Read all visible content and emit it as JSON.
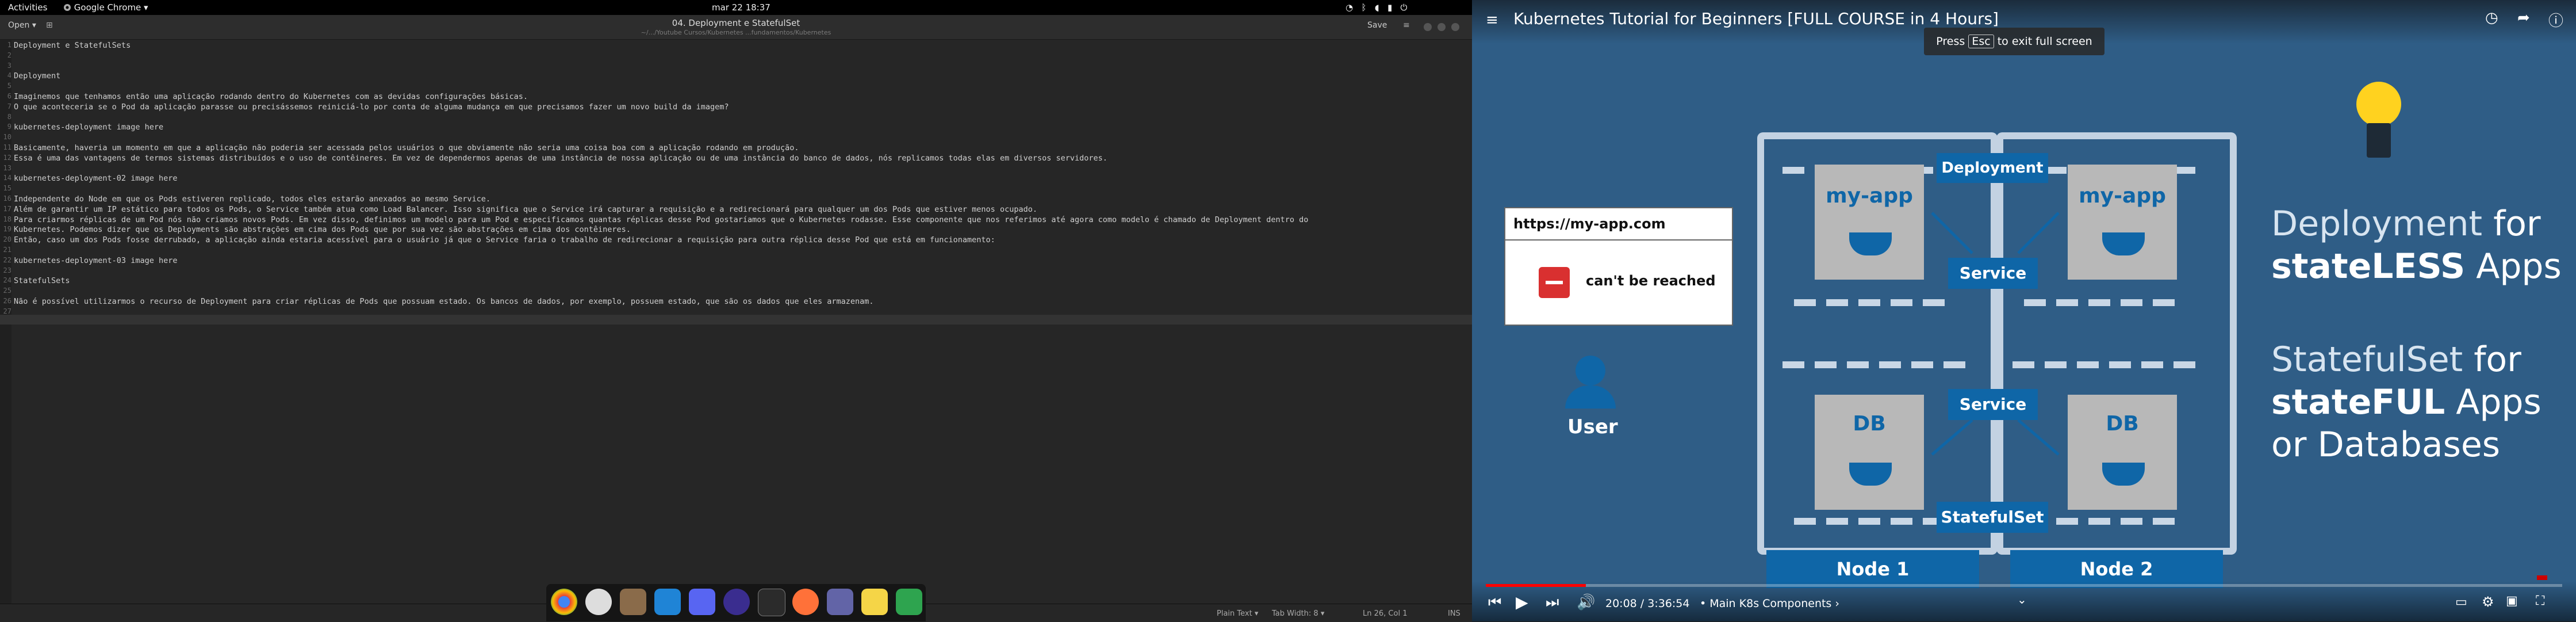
{
  "system": {
    "activities": "Activities",
    "app_name": "Google Chrome ▾",
    "datetime": "mar 22 18:37"
  },
  "editor": {
    "open_label": "Open",
    "save_label": "Save",
    "doc_title": "04. Deployment e StatefulSet",
    "doc_path": "~/.../Youtube Cursos/Kubernetes ...fundamentos/Kubernetes",
    "lines": [
      "Deployment e StatefulSets",
      "",
      "",
      "Deployment",
      "",
      "Imaginemos que tenhamos então uma aplicação rodando dentro do Kubernetes com as devidas configurações básicas.",
      "O que aconteceria se o Pod da aplicação parasse ou precisássemos reiniciá-lo por conta de alguma mudança em que precisamos fazer um novo build da imagem?",
      "",
      "kubernetes-deployment image here",
      "",
      "Basicamente, haveria um momento em que a aplicação não poderia ser acessada pelos usuários o que obviamente não seria uma coisa boa com a aplicação rodando em produção.",
      "Essa é uma das vantagens de termos sistemas distribuídos e o uso de contêineres. Em vez de dependermos apenas de uma instância de nossa aplicação ou de uma instância do banco de dados, nós replicamos todas elas em diversos servidores.",
      "",
      "kubernetes-deployment-02 image here",
      "",
      "Independente do Node em que os Pods estiveren replicado, todos eles estarão anexados ao mesmo Service.",
      "Além de garantir um IP estático para todos os Pods, o Service também atua como Load Balancer. Isso significa que o Service irá capturar a requisição e a redirecionará para qualquer um dos Pods que estiver menos ocupado.",
      "Para criarmos réplicas de um Pod nós não criamos novos Pods. Em vez disso, definimos um modelo para um Pod e especificamos quantas réplicas desse Pod gostaríamos que o Kubernetes rodasse. Esse componente que nos referimos até agora como modelo é chamado de Deployment dentro do",
      "Kubernetes. Podemos dizer que os Deployments são abstrações em cima dos Pods que por sua vez são abstrações em cima dos contêineres.",
      "Então, caso um dos Pods fosse derrubado, a aplicação ainda estaria acessível para o usuário já que o Service faria o trabalho de redirecionar a requisição para outra réplica desse Pod que está em funcionamento:",
      "",
      "kubernetes-deployment-03 image here",
      "",
      "StatefulSets",
      "",
      "Não é possível utilizarmos o recurso de Deployment para criar réplicas de Pods que possuam estado. Os bancos de dados, por exemplo, possuem estado, que são os dados que eles armazenam.",
      ""
    ],
    "status": {
      "syntax": "Plain Text ▾",
      "tab_width": "Tab Width: 8 ▾",
      "position": "Ln 26, Col 1",
      "mode": "INS"
    }
  },
  "video": {
    "title": "Kubernetes Tutorial for Beginners [FULL COURSE in 4 Hours]",
    "fullscreen_hint_before": "Press",
    "fullscreen_hint_key": "Esc",
    "fullscreen_hint_after": "to exit full screen",
    "url": "https://my-app.com",
    "cant_reach": "can't be reached",
    "user_label": "User",
    "app_label": "my-app",
    "db_label": "DB",
    "deployment_label": "Deployment",
    "service_label": "Service",
    "statefulset_label": "StatefulSet",
    "node1": "Node 1",
    "node2": "Node 2",
    "text_deploy_1": "Deployment",
    "text_deploy_2": "for",
    "text_stateless_1": "stateLESS",
    "text_stateless_2": "Apps",
    "text_sts_1": "StatefulSet",
    "text_sts_2": "for",
    "text_stateful_1": "stateFUL",
    "text_stateful_2": "Apps",
    "text_or_db": "or Databases",
    "time": "20:08 / 3:36:54",
    "chapter": "• Main K8s Components ›",
    "progress": 0.093
  }
}
